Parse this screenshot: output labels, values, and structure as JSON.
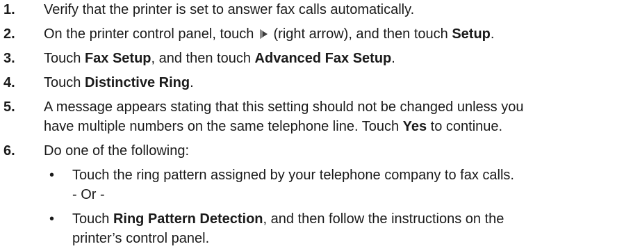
{
  "steps": [
    {
      "num": "1.",
      "parts": [
        {
          "t": "Verify that the printer is set to answer fax calls automatically."
        }
      ]
    },
    {
      "num": "2.",
      "parts": [
        {
          "t": "On the printer control panel, touch "
        },
        {
          "icon": "right-arrow-icon"
        },
        {
          "t": " (right arrow), and then touch "
        },
        {
          "b": "Setup"
        },
        {
          "t": "."
        }
      ]
    },
    {
      "num": "3.",
      "parts": [
        {
          "t": "Touch "
        },
        {
          "b": "Fax Setup"
        },
        {
          "t": ", and then touch "
        },
        {
          "b": "Advanced Fax Setup"
        },
        {
          "t": "."
        }
      ]
    },
    {
      "num": "4.",
      "parts": [
        {
          "t": "Touch "
        },
        {
          "b": "Distinctive Ring"
        },
        {
          "t": "."
        }
      ]
    },
    {
      "num": "5.",
      "parts": [
        {
          "t": "A message appears stating that this setting should not be changed unless you"
        }
      ],
      "parts2": [
        {
          "t": "have multiple numbers on the same telephone line. Touch "
        },
        {
          "b": "Yes"
        },
        {
          "t": " to continue."
        }
      ]
    },
    {
      "num": "6.",
      "parts": [
        {
          "t": "Do one of the following:"
        }
      ]
    }
  ],
  "options": [
    {
      "bullet": "•",
      "parts": [
        {
          "t": "Touch the ring pattern assigned by your telephone company to fax calls."
        }
      ]
    },
    {
      "bullet": "",
      "parts": [
        {
          "t": "- Or -"
        }
      ]
    },
    {
      "bullet": "•",
      "parts": [
        {
          "t": "Touch "
        },
        {
          "b": "Ring Pattern Detection"
        },
        {
          "t": ", and then follow the instructions on the"
        }
      ]
    },
    {
      "bullet": "",
      "parts": [
        {
          "t": "printer’s control panel."
        }
      ]
    }
  ]
}
